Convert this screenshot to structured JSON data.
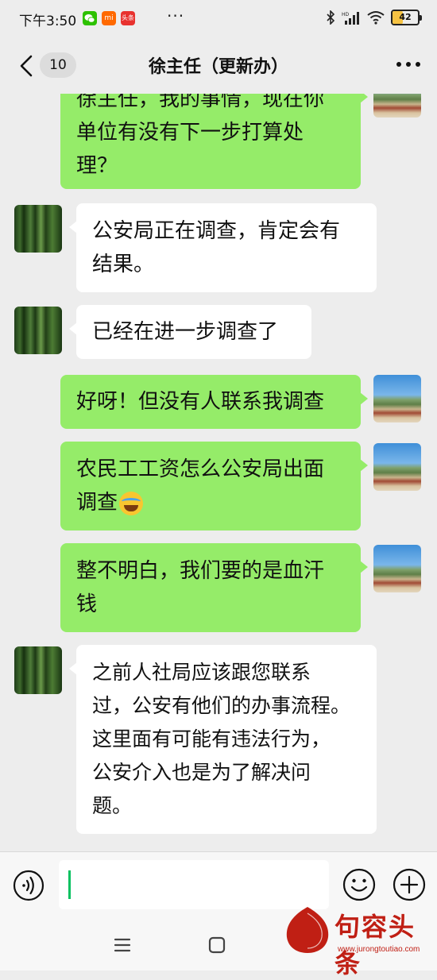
{
  "status_bar": {
    "time": "下午3:50",
    "app_icons": [
      {
        "name": "wechat-app-icon",
        "text": "",
        "color": "#2dc100"
      },
      {
        "name": "mi-app-icon",
        "text": "mi",
        "color": "#ff6900"
      },
      {
        "name": "toutiao-app-icon",
        "text": "头条",
        "color": "#e8322f"
      }
    ],
    "more": "···",
    "battery": "42",
    "battery_level": 0.42,
    "indicators": [
      "bluetooth-icon",
      "hd-signal-icon",
      "wifi-icon"
    ]
  },
  "nav": {
    "back_icon": "chevron-left-icon",
    "unread_count": "10",
    "title": "徐主任（更新办）",
    "more_icon": "more-dots-icon"
  },
  "messages": [
    {
      "from": "me",
      "text": "徐主任，我的事情，现在你单位有没有下一步打算处理？",
      "lines": [
        "徐主任，我的事情，现在你",
        "单位有没有下一步打算处",
        "理？"
      ]
    },
    {
      "from": "contact",
      "text": "公安局正在调查，肯定会有结果。",
      "lines": [
        "公安局正在调查，肯定会有",
        "结果。"
      ]
    },
    {
      "from": "contact",
      "text": "已经在进一步调查了",
      "lines": [
        "已经在进一步调查了"
      ]
    },
    {
      "from": "me",
      "text": "好呀！但没有人联系我调查",
      "lines": [
        "好呀！但没有人联系我调查"
      ]
    },
    {
      "from": "me",
      "text": "农民工工资怎么公安局出面调查",
      "lines": [
        "农民工工资怎么公安局出面",
        "调查"
      ],
      "emoji": "crying-laugh-emoji"
    },
    {
      "from": "me",
      "text": "整不明白，我们要的是血汗钱",
      "lines": [
        "整不明白，我们要的是血汗",
        "钱"
      ]
    },
    {
      "from": "contact",
      "text": "之前人社局应该跟您联系过，公安有他们的办事流程。这里面有可能有违法行为，公安介入也是为了解决问题。",
      "lines": [
        "之前人社局应该跟您联系",
        "过，公安有他们的办事流程。",
        "这里面有可能有违法行为，",
        "公安介入也是为了解决问",
        "题。"
      ]
    }
  ],
  "input_bar": {
    "voice_icon": "voice-icon",
    "input_value": "",
    "emoji_icon": "smiley-icon",
    "plus_icon": "plus-icon"
  },
  "system_nav": {
    "menu_icon": "menu-icon",
    "home_icon": "home-square-icon"
  },
  "watermark": {
    "seal_text": "句容头条",
    "name": "句容头条",
    "url": "www.jurongtoutiao.com"
  },
  "colors": {
    "background": "#ededed",
    "my_bubble": "#95ec69",
    "their_bubble": "#ffffff",
    "accent": "#07c160",
    "watermark_red": "#c01f14"
  }
}
